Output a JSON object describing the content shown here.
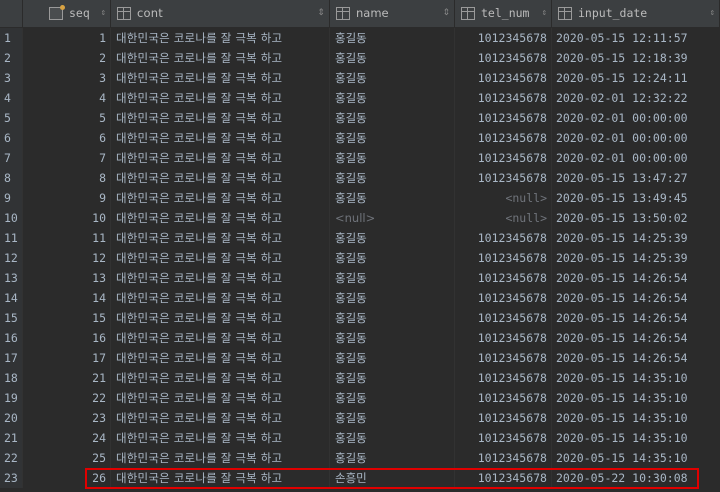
{
  "columns": [
    {
      "label": "seq",
      "icon": "primary-key-column-icon"
    },
    {
      "label": "cont",
      "icon": "column-icon"
    },
    {
      "label": "name",
      "icon": "column-icon"
    },
    {
      "label": "tel_num",
      "icon": "column-icon"
    },
    {
      "label": "input_date",
      "icon": "column-icon"
    }
  ],
  "sort_glyph": "⇕",
  "rows": [
    {
      "n": "1",
      "seq": "1",
      "cont": "대한민국은 코로나를 잘 극복 하고",
      "name": "홍길동",
      "tel": "1012345678",
      "date": "2020-05-15 12:11:57"
    },
    {
      "n": "2",
      "seq": "2",
      "cont": "대한민국은 코로나를 잘 극복 하고",
      "name": "홍길동",
      "tel": "1012345678",
      "date": "2020-05-15 12:18:39"
    },
    {
      "n": "3",
      "seq": "3",
      "cont": "대한민국은 코로나를 잘 극복 하고",
      "name": "홍길동",
      "tel": "1012345678",
      "date": "2020-05-15 12:24:11"
    },
    {
      "n": "4",
      "seq": "4",
      "cont": "대한민국은 코로나를 잘 극복 하고",
      "name": "홍길동",
      "tel": "1012345678",
      "date": "2020-02-01 12:32:22"
    },
    {
      "n": "5",
      "seq": "5",
      "cont": "대한민국은 코로나를 잘 극복 하고",
      "name": "홍길동",
      "tel": "1012345678",
      "date": "2020-02-01 00:00:00"
    },
    {
      "n": "6",
      "seq": "6",
      "cont": "대한민국은 코로나를 잘 극복 하고",
      "name": "홍길동",
      "tel": "1012345678",
      "date": "2020-02-01 00:00:00"
    },
    {
      "n": "7",
      "seq": "7",
      "cont": "대한민국은 코로나를 잘 극복 하고",
      "name": "홍길동",
      "tel": "1012345678",
      "date": "2020-02-01 00:00:00"
    },
    {
      "n": "8",
      "seq": "8",
      "cont": "대한민국은 코로나를 잘 극복 하고",
      "name": "홍길동",
      "tel": "1012345678",
      "date": "2020-05-15 13:47:27"
    },
    {
      "n": "9",
      "seq": "9",
      "cont": "대한민국은 코로나를 잘 극복 하고",
      "name": "홍길동",
      "tel": "<null>",
      "date": "2020-05-15 13:49:45"
    },
    {
      "n": "10",
      "seq": "10",
      "cont": "대한민국은 코로나를 잘 극복 하고",
      "name": "<null>",
      "tel": "<null>",
      "date": "2020-05-15 13:50:02"
    },
    {
      "n": "11",
      "seq": "11",
      "cont": "대한민국은 코로나를 잘 극복 하고",
      "name": "홍길동",
      "tel": "1012345678",
      "date": "2020-05-15 14:25:39"
    },
    {
      "n": "12",
      "seq": "12",
      "cont": "대한민국은 코로나를 잘 극복 하고",
      "name": "홍길동",
      "tel": "1012345678",
      "date": "2020-05-15 14:25:39"
    },
    {
      "n": "13",
      "seq": "13",
      "cont": "대한민국은 코로나를 잘 극복 하고",
      "name": "홍길동",
      "tel": "1012345678",
      "date": "2020-05-15 14:26:54"
    },
    {
      "n": "14",
      "seq": "14",
      "cont": "대한민국은 코로나를 잘 극복 하고",
      "name": "홍길동",
      "tel": "1012345678",
      "date": "2020-05-15 14:26:54"
    },
    {
      "n": "15",
      "seq": "15",
      "cont": "대한민국은 코로나를 잘 극복 하고",
      "name": "홍길동",
      "tel": "1012345678",
      "date": "2020-05-15 14:26:54"
    },
    {
      "n": "16",
      "seq": "16",
      "cont": "대한민국은 코로나를 잘 극복 하고",
      "name": "홍길동",
      "tel": "1012345678",
      "date": "2020-05-15 14:26:54"
    },
    {
      "n": "17",
      "seq": "17",
      "cont": "대한민국은 코로나를 잘 극복 하고",
      "name": "홍길동",
      "tel": "1012345678",
      "date": "2020-05-15 14:26:54"
    },
    {
      "n": "18",
      "seq": "21",
      "cont": "대한민국은 코로나를 잘 극복 하고",
      "name": "홍길동",
      "tel": "1012345678",
      "date": "2020-05-15 14:35:10"
    },
    {
      "n": "19",
      "seq": "22",
      "cont": "대한민국은 코로나를 잘 극복 하고",
      "name": "홍길동",
      "tel": "1012345678",
      "date": "2020-05-15 14:35:10"
    },
    {
      "n": "20",
      "seq": "23",
      "cont": "대한민국은 코로나를 잘 극복 하고",
      "name": "홍길동",
      "tel": "1012345678",
      "date": "2020-05-15 14:35:10"
    },
    {
      "n": "21",
      "seq": "24",
      "cont": "대한민국은 코로나를 잘 극복 하고",
      "name": "홍길동",
      "tel": "1012345678",
      "date": "2020-05-15 14:35:10"
    },
    {
      "n": "22",
      "seq": "25",
      "cont": "대한민국은 코로나를 잘 극복 하고",
      "name": "홍길동",
      "tel": "1012345678",
      "date": "2020-05-15 14:35:10"
    },
    {
      "n": "23",
      "seq": "26",
      "cont": "대한민국은 코로나를 잘 극복 하고",
      "name": "손흥민",
      "tel": "1012345678",
      "date": "2020-05-22 10:30:08"
    }
  ],
  "highlight_row_index": 22,
  "colors": {
    "background": "#2b2b2b",
    "header": "#3c3f41",
    "text": "#a9b7c6",
    "null_text": "#6f737a",
    "highlight_border": "#e00000"
  }
}
